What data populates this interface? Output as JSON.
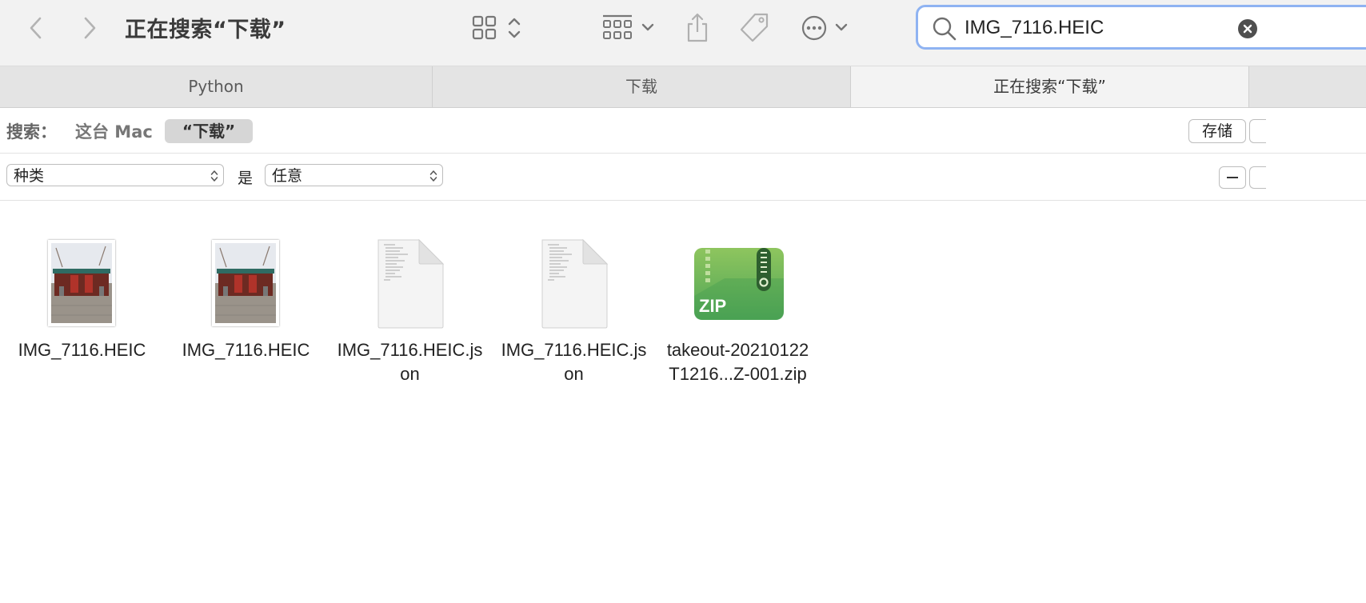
{
  "toolbar": {
    "back_icon": "chevron-left-icon",
    "forward_icon": "chevron-right-icon",
    "title": "正在搜索“下载”",
    "view_icon": "grid-view-icon",
    "group_icon": "group-by-icon",
    "share_icon": "share-icon",
    "tag_icon": "tag-icon",
    "more_icon": "ellipsis-circle-icon"
  },
  "search": {
    "value": "IMG_7116.HEIC",
    "focus_ring_color": "#8fb3f2"
  },
  "tabs": [
    {
      "label": "Python",
      "active": false
    },
    {
      "label": "下载",
      "active": false
    },
    {
      "label": "正在搜索“下载”",
      "active": true
    }
  ],
  "scope": {
    "label": "搜索：",
    "this_mac": "这台 Mac",
    "downloads": "“下载”",
    "save_label": "存储"
  },
  "criteria": {
    "attribute": "种类",
    "operator": "是",
    "value": "任意"
  },
  "files": [
    {
      "name": "IMG_7116.HEIC",
      "kind": "photo"
    },
    {
      "name": "IMG_7116.HEIC",
      "kind": "photo"
    },
    {
      "name": "IMG_7116.HEIC.json",
      "kind": "document"
    },
    {
      "name": "IMG_7116.HEIC.json",
      "kind": "document"
    },
    {
      "name": "takeout-20210122T1216...Z-001.zip",
      "kind": "zip",
      "icon_label": "ZIP"
    }
  ]
}
